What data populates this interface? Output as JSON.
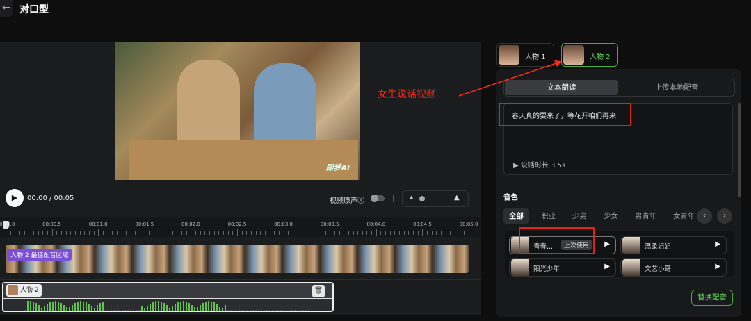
{
  "header": {
    "back_icon": "arrow-left-icon",
    "title": "对口型"
  },
  "player": {
    "time": "00:00 / 00:05",
    "original_audio_label": "视频原声ⓘ",
    "original_audio_on": false,
    "watermark": "即梦AI"
  },
  "timeline": {
    "ticks": [
      "00:00.0",
      "00:00.5",
      "00:01.0",
      "00:01.5",
      "00:02.0",
      "00:02.5",
      "00:03.0",
      "00:03.5",
      "00:04.0",
      "00:04.5",
      "00:05.0"
    ],
    "video_badge": "人物 2 最佳配音区域",
    "audio_chip": "人物 2"
  },
  "characters": [
    {
      "label": "人物 1",
      "active": false
    },
    {
      "label": "人物 2",
      "active": true
    }
  ],
  "annotation": {
    "text": "女生说话视频",
    "color": "#ff2a1a"
  },
  "panel": {
    "tabs": [
      {
        "label": "文本朗读",
        "active": true
      },
      {
        "label": "上传本地配音",
        "active": false
      }
    ],
    "text": "春天真的要来了，等花开咱们再来",
    "duration": "说话时长 3.5s",
    "voice_label": "音色",
    "categories": [
      "全部",
      "职业",
      "少男",
      "少女",
      "男青年",
      "女青年"
    ],
    "voices": [
      {
        "name": "青春...",
        "badge": "上次使用"
      },
      {
        "name": "温柔姐姐"
      },
      {
        "name": "阳光少年"
      },
      {
        "name": "文艺小哥"
      }
    ],
    "replace_button": "替换配音"
  },
  "colors": {
    "accent": "#5ed35a",
    "badge": "#7b4fd6"
  }
}
